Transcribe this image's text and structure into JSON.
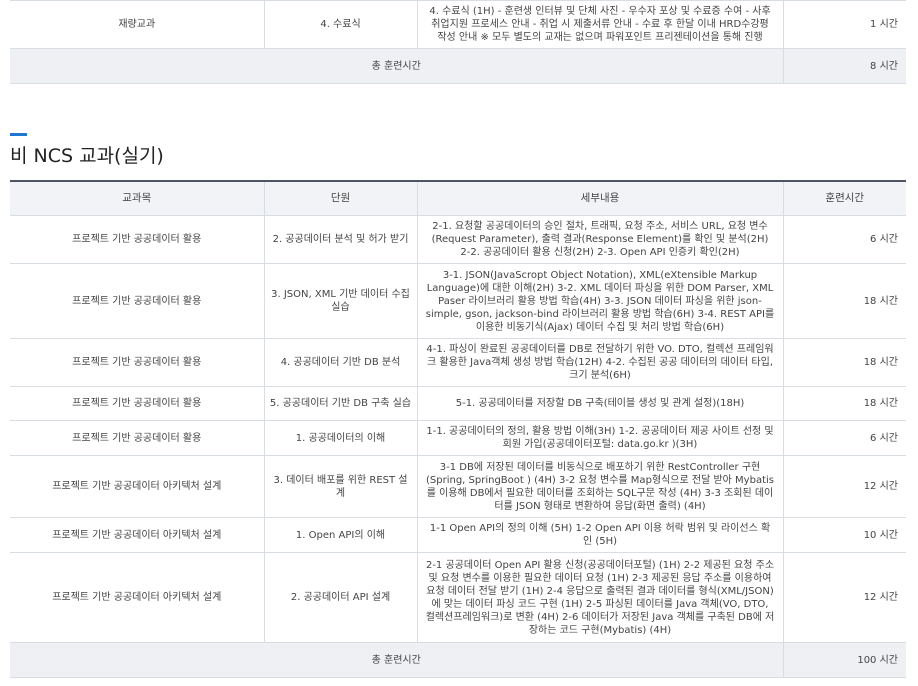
{
  "top_table": {
    "row": {
      "subject": "재량교과",
      "unit": "4. 수료식",
      "detail": "4. 수료식 (1H) - 훈련생 인터뷰 및 단체 사진 - 우수자 포상 및 수료증 수여 - 사후 취업지원 프로세스 안내 - 취업 시 제출서류 안내 - 수료 후 한달 이내 HRD수강평 작성 안내 ※ 모두 별도의 교재는 없으며 파워포인트 프리젠테이션을 통해 진행",
      "hours": "1 시간"
    },
    "total_label": "총 훈련시간",
    "total_hours": "8 시간"
  },
  "section": {
    "title": "비 NCS 교과(실기)"
  },
  "main_table": {
    "headers": {
      "subject": "교과목",
      "unit": "단원",
      "detail": "세부내용",
      "hours": "훈련시간"
    },
    "rows": [
      {
        "subject": "프로젝트 기반 공공데이터 활용",
        "unit": "2. 공공데이터 분석 및 허가 받기",
        "detail": "2-1. 요청할 공공데이터의 승인 절차, 트래픽, 요청 주소, 서비스 URL, 요청 변수(Request Parameter), 출력 결과(Response Element)를 확인 및 분석(2H) 2-2. 공공데이터 활용 신청(2H) 2-3. Open API 인증키 확인(2H)",
        "hours": "6 시간"
      },
      {
        "subject": "프로젝트 기반 공공데이터 활용",
        "unit": "3. JSON, XML 기반 데이터 수집 실습",
        "detail": "3-1. JSON(JavaScropt Object Notation), XML(eXtensible Markup Language)에 대한 이해(2H) 3-2. XML 데이터 파싱을 위한 DOM Parser, XML Paser 라이브러리 활용 방법 학습(4H) 3-3. JSON 데이터 파싱을 위한 json-simple, gson, jackson-bind 라이브러리 활용 방법 학습(6H) 3-4. REST API를 이용한 비동기식(Ajax) 데이터 수집 및 처리 방법 학습(6H)",
        "hours": "18 시간"
      },
      {
        "subject": "프로젝트 기반 공공데이터 활용",
        "unit": "4. 공공데이터 기반 DB 분석",
        "detail": "4-1. 파싱이 완료된 공공데이터를 DB로 전달하기 위한 VO. DTO, 컬렉션 프레임워크 활용한 Java객체 생성 방법 학습(12H) 4-2. 수집된 공공 데이터의 데이터 타입, 크기 분석(6H)",
        "hours": "18 시간"
      },
      {
        "subject": "프로젝트 기반 공공데이터 활용",
        "unit": "5. 공공데이터 기반 DB 구축 실습",
        "detail": "5-1. 공공데이터를 저장할 DB 구축(테이블 생성 및 관계 설정)(18H)",
        "hours": "18 시간"
      },
      {
        "subject": "프로젝트 기반 공공데이터 활용",
        "unit": "1. 공공데이터의 이해",
        "detail": "1-1. 공공데이터의 정의, 활용 방법 이해(3H) 1-2. 공공데이터 제공 사이트 선정 및 회원 가입(공공데이터포털: data.go.kr )(3H)",
        "hours": "6 시간"
      },
      {
        "subject": "프로젝트 기반 공공데이터 아키텍처 설계",
        "unit": "3. 데이터 배포를 위한 REST 설계",
        "detail": "3-1 DB에 저장된 데이터를 비동식으로 배포하기 위한 RestController 구현(Spring, SpringBoot ) (4H) 3-2 요청 변수를 Map형식으로 전달 받아 Mybatis를 이용해 DB에서 필요한 데이터를 조회하는 SQL구문 작성 (4H) 3-3 조회된 데이터를 JSON 형태로 변환하여 응답(화면 출력) (4H)",
        "hours": "12 시간"
      },
      {
        "subject": "프로젝트 기반 공공데이터 아키텍처 설계",
        "unit": "1. Open API의 이해",
        "detail": "1-1 Open API의 정의 이해 (5H) 1-2 Open API 이용 허락 범위 및 라이선스 확인 (5H)",
        "hours": "10 시간"
      },
      {
        "subject": "프로젝트 기반 공공데이터 아키텍처 설계",
        "unit": "2. 공공데이터 API 설계",
        "detail": "2-1 공공데이터 Open API 활용 신청(공공데이터포털) (1H) 2-2 제공된 요청 주소 및 요청 변수를 이용한 필요한 데이터 요청 (1H) 2-3 제공된 응답 주소를 이용하여 요청 데이터 전달 받기 (1H) 2-4 응답으로 출력된 결과 데이터를 형식(XML/JSON)에 맞는 데이터 파싱 코드 구현 (1H) 2-5 파싱된 데이터를 Java 객체(VO, DTO, 컬렉션프레임워크)로 변환 (4H) 2-6 데이터가 저장된 Java 객체를 구축된 DB에 저장하는 코드 구현(Mybatis) (4H)",
        "hours": "12 시간"
      }
    ],
    "total_label": "총 훈련시간",
    "total_hours": "100 시간"
  },
  "colors": {
    "header_bg": "#f1f3f6",
    "total_bg": "#eef0f3",
    "border": "#d8dde3",
    "table_top_border": "#4d5563",
    "section_accent": "#1e76d2"
  }
}
